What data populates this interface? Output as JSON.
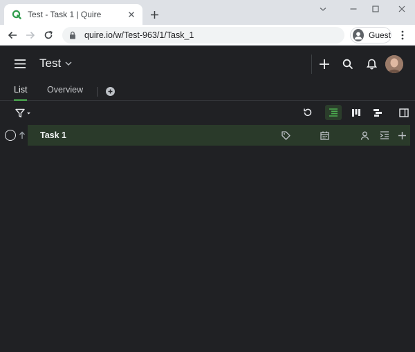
{
  "browser": {
    "tab_title": "Test - Task 1 | Quire",
    "url": "quire.io/w/Test-963/1/Task_1",
    "profile_label": "Guest",
    "icons": [
      "quire-favicon",
      "close-icon",
      "plus-icon",
      "minimize-icon",
      "maximize-icon",
      "close-window-icon",
      "back-arrow-icon",
      "forward-arrow-icon",
      "reload-icon",
      "lock-icon",
      "profile-icon",
      "kebab-menu-icon"
    ]
  },
  "app": {
    "project_title": "Test",
    "tabs": [
      {
        "label": "List",
        "active": true
      },
      {
        "label": "Overview",
        "active": false
      }
    ],
    "header_icons": [
      "hamburger-icon",
      "chevron-down-icon",
      "plus-icon",
      "search-icon",
      "bell-icon",
      "avatar"
    ],
    "toolbar_icons": [
      "filter-icon",
      "undo-icon",
      "list-view-icon",
      "board-view-icon",
      "timeline-view-icon",
      "side-panel-icon"
    ],
    "task": {
      "title": "Task 1",
      "icons": [
        "tag-icon",
        "calendar-icon",
        "person-icon",
        "indent-icon",
        "add-subtask-icon"
      ]
    },
    "colors": {
      "accent": "#4caf50",
      "background": "#202124",
      "task_highlight": "#2a3a2a"
    }
  }
}
